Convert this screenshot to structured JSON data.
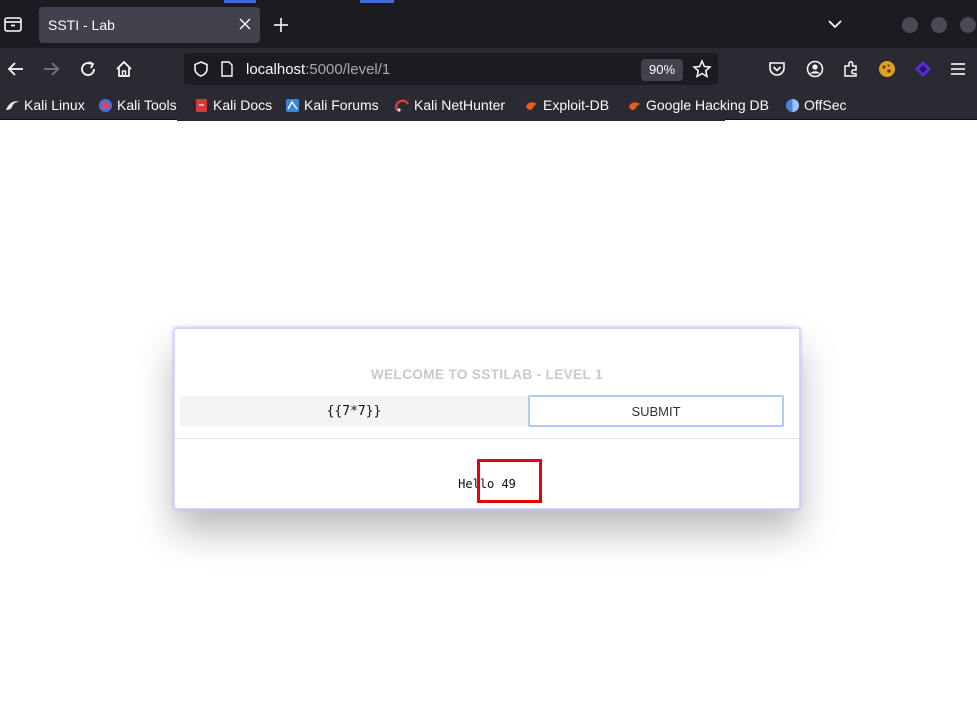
{
  "browser": {
    "tab_title": "SSTI - Lab",
    "url_host": "localhost",
    "url_rest": ":5000/level/1",
    "zoom": "90%"
  },
  "bookmarks": [
    {
      "label": "Kali Linux",
      "icon": "kali-dragon-icon",
      "color": "#e6e6e6"
    },
    {
      "label": "Kali Tools",
      "icon": "kali-tools-icon",
      "color": "#d9475b"
    },
    {
      "label": "Kali Docs",
      "icon": "kali-docs-icon",
      "color": "#d63a3a"
    },
    {
      "label": "Kali Forums",
      "icon": "kali-forums-icon",
      "color": "#3a86d6"
    },
    {
      "label": "Kali NetHunter",
      "icon": "nethunter-icon",
      "color": "#e03c3c"
    },
    {
      "label": "Exploit-DB",
      "icon": "exploit-db-icon",
      "color": "#e85d1c"
    },
    {
      "label": "Google Hacking DB",
      "icon": "ghdb-icon",
      "color": "#e85d1c"
    },
    {
      "label": "OffSec",
      "icon": "offsec-icon",
      "color": "#4d7fe0"
    }
  ],
  "page": {
    "title": "WELCOME TO SSTILAB - LEVEL 1",
    "input_value": "{{7*7}}",
    "submit_label": "SUBMIT",
    "result_text": "Hello 49"
  },
  "colors": {
    "highlight": "#e8000b",
    "card_glow": "#c8c3ff",
    "button_border": "#aecbf3"
  }
}
